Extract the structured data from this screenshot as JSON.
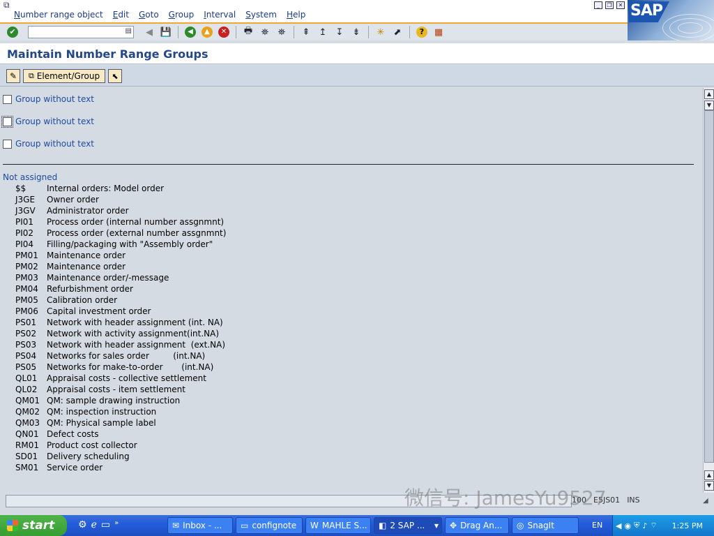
{
  "menu": {
    "items": [
      "Number range object",
      "Edit",
      "Goto",
      "Group",
      "Interval",
      "System",
      "Help"
    ]
  },
  "window_controls": {
    "minimize": "_",
    "restore": "❐",
    "close": "✕"
  },
  "logo": {
    "text": "SAP"
  },
  "toolbar": {
    "command_placeholder": "",
    "icons": [
      "check-icon",
      "back-icon",
      "save-icon",
      "back-nav-icon",
      "exit-icon",
      "cancel-icon",
      "print-icon",
      "find-icon",
      "find-next-icon",
      "first-page-icon",
      "previous-page-icon",
      "next-page-icon",
      "last-page-icon",
      "new-session-icon",
      "shortcut-icon",
      "help-icon",
      "layout-icon"
    ]
  },
  "title": "Maintain Number Range Groups",
  "app_toolbar": {
    "element_group_label": "Element/Group"
  },
  "groups": [
    {
      "label": "Group without text",
      "checked": false
    },
    {
      "label": "Group without text",
      "checked": false,
      "focused": true
    },
    {
      "label": "Group without text",
      "checked": false
    }
  ],
  "not_assigned_label": "Not assigned",
  "items": [
    {
      "code": "$$",
      "text": "Internal orders: Model order"
    },
    {
      "code": "J3GE",
      "text": "Owner order"
    },
    {
      "code": "J3GV",
      "text": "Administrator order"
    },
    {
      "code": "PI01",
      "text": "Process order (internal number assgnmnt)"
    },
    {
      "code": "PI02",
      "text": "Process order (external number assgnmnt)"
    },
    {
      "code": "PI04",
      "text": "Filling/packaging with \"Assembly order\""
    },
    {
      "code": "PM01",
      "text": "Maintenance order"
    },
    {
      "code": "PM02",
      "text": "Maintenance order"
    },
    {
      "code": "PM03",
      "text": "Maintenance order/-message"
    },
    {
      "code": "PM04",
      "text": "Refurbishment order"
    },
    {
      "code": "PM05",
      "text": "Calibration order"
    },
    {
      "code": "PM06",
      "text": "Capital investment order"
    },
    {
      "code": "PS01",
      "text": "Network with header assignment (int. NA)"
    },
    {
      "code": "PS02",
      "text": "Network with activity assignment(int.NA)"
    },
    {
      "code": "PS03",
      "text": "Network with header assignment  (ext.NA)"
    },
    {
      "code": "PS04",
      "text": "Networks for sales order         (int.NA)"
    },
    {
      "code": "PS05",
      "text": "Networks for make-to-order       (int.NA)"
    },
    {
      "code": "QL01",
      "text": "Appraisal costs - collective settlement"
    },
    {
      "code": "QL02",
      "text": "Appraisal costs - item settlement"
    },
    {
      "code": "QM01",
      "text": "QM: sample drawing instruction"
    },
    {
      "code": "QM02",
      "text": "QM: inspection instruction"
    },
    {
      "code": "QM03",
      "text": "QM: Physical sample label"
    },
    {
      "code": "QN01",
      "text": "Defect costs"
    },
    {
      "code": "RM01",
      "text": "Product cost collector"
    },
    {
      "code": "SD01",
      "text": "Delivery scheduling"
    },
    {
      "code": "SM01",
      "text": "Service order"
    }
  ],
  "status": {
    "message": "",
    "client": "100",
    "server": "E5JS01",
    "mode": "INS"
  },
  "watermark": "微信号: JamesYu9527",
  "taskbar": {
    "start_label": "start",
    "tasks": [
      {
        "label": "Inbox - ...",
        "icon": "outlook-icon"
      },
      {
        "label": "confignote",
        "icon": "folder-icon"
      },
      {
        "label": "MAHLE S...",
        "icon": "word-icon"
      },
      {
        "label": "2 SAP ...",
        "icon": "sap-gui-icon",
        "active": true
      },
      {
        "label": "Drag An...",
        "icon": "drag-icon"
      },
      {
        "label": "SnagIt",
        "icon": "snagit-icon"
      }
    ],
    "language": "EN",
    "time": "1:25 PM"
  }
}
